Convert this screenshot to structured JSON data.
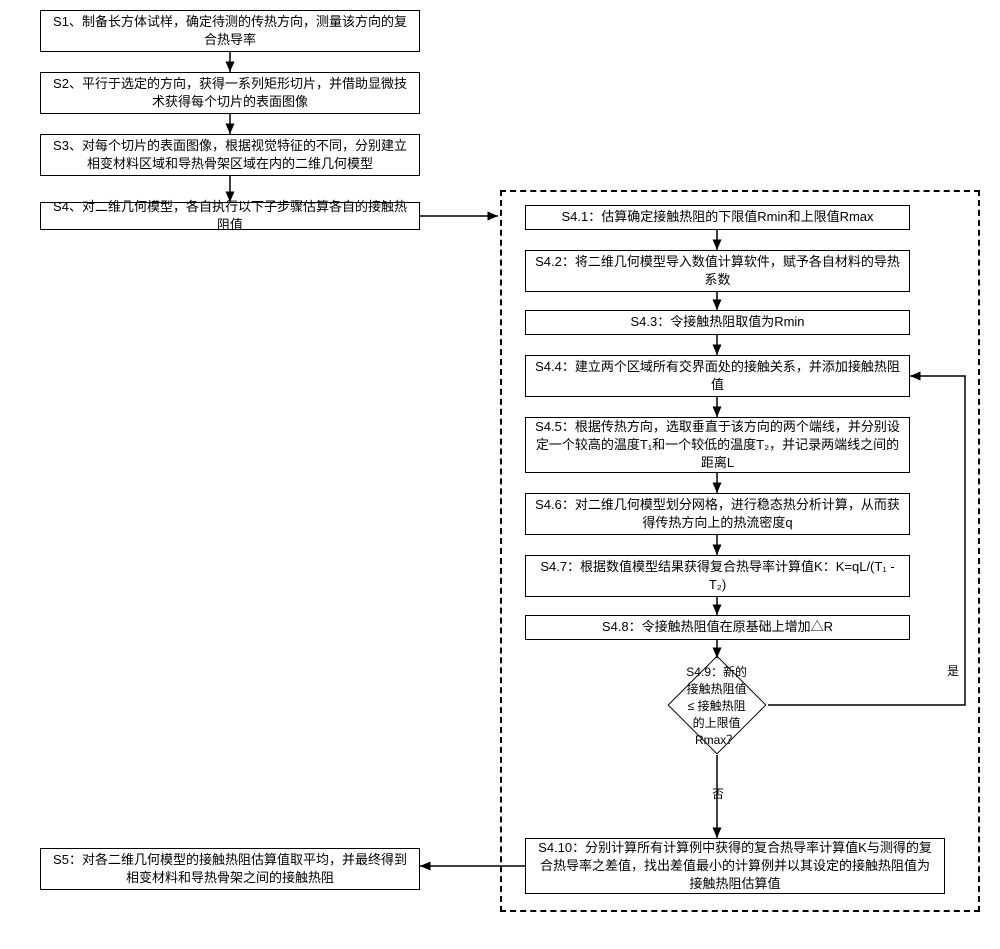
{
  "chart_data": {
    "type": "flowchart",
    "title": "",
    "nodes": [
      {
        "id": "S1",
        "type": "process",
        "text": "S1、制备长方体试样，确定待测的传热方向，测量该方向的复合热导率"
      },
      {
        "id": "S2",
        "type": "process",
        "text": "S2、平行于选定的方向，获得一系列矩形切片，并借助显微技术获得每个切片的表面图像"
      },
      {
        "id": "S3",
        "type": "process",
        "text": "S3、对每个切片的表面图像，根据视觉特征的不同，分别建立相变材料区域和导热骨架区域在内的二维几何模型"
      },
      {
        "id": "S4",
        "type": "process",
        "text": "S4、对二维几何模型，各自执行以下子步骤估算各自的接触热阻值"
      },
      {
        "id": "S4.1",
        "type": "process",
        "text": "S4.1：估算确定接触热阻的下限值Rmin和上限值Rmax"
      },
      {
        "id": "S4.2",
        "type": "process",
        "text": "S4.2：将二维几何模型导入数值计算软件，赋予各自材料的导热系数"
      },
      {
        "id": "S4.3",
        "type": "process",
        "text": "S4.3：令接触热阻取值为Rmin"
      },
      {
        "id": "S4.4",
        "type": "process",
        "text": "S4.4：建立两个区域所有交界面处的接触关系，并添加接触热阻值"
      },
      {
        "id": "S4.5",
        "type": "process",
        "text": "S4.5：根据传热方向，选取垂直于该方向的两个端线，并分别设定一个较高的温度T₁和一个较低的温度T₂，并记录两端线之间的距离L"
      },
      {
        "id": "S4.6",
        "type": "process",
        "text": "S4.6：对二维几何模型划分网格，进行稳态热分析计算，从而获得传热方向上的热流密度q"
      },
      {
        "id": "S4.7",
        "type": "process",
        "text": "S4.7：根据数值模型结果获得复合热导率计算值K：K=qL/(T₁ - T₂)"
      },
      {
        "id": "S4.8",
        "type": "process",
        "text": "S4.8：令接触热阻值在原基础上增加△R"
      },
      {
        "id": "S4.9",
        "type": "decision",
        "text": "S4.9：新的接触热阻值 ≤ 接触热阻的上限值Rmax？"
      },
      {
        "id": "S4.10",
        "type": "process",
        "text": "S4.10：分别计算所有计算例中获得的复合热导率计算值K与测得的复合热导率之差值，找出差值最小的计算例并以其设定的接触热阻值为接触热阻估算值"
      },
      {
        "id": "S5",
        "type": "process",
        "text": "S5：对各二维几何模型的接触热阻估算值取平均，并最终得到相变材料和导热骨架之间的接触热阻"
      }
    ],
    "edges": [
      {
        "from": "S1",
        "to": "S2"
      },
      {
        "from": "S2",
        "to": "S3"
      },
      {
        "from": "S3",
        "to": "S4"
      },
      {
        "from": "S4",
        "to": "S4.1"
      },
      {
        "from": "S4.1",
        "to": "S4.2"
      },
      {
        "from": "S4.2",
        "to": "S4.3"
      },
      {
        "from": "S4.3",
        "to": "S4.4"
      },
      {
        "from": "S4.4",
        "to": "S4.5"
      },
      {
        "from": "S4.5",
        "to": "S4.6"
      },
      {
        "from": "S4.6",
        "to": "S4.7"
      },
      {
        "from": "S4.7",
        "to": "S4.8"
      },
      {
        "from": "S4.8",
        "to": "S4.9"
      },
      {
        "from": "S4.9",
        "to": "S4.4",
        "label": "是"
      },
      {
        "from": "S4.9",
        "to": "S4.10",
        "label": "否"
      },
      {
        "from": "S4.10",
        "to": "S5"
      }
    ]
  },
  "steps": {
    "s1": "S1、制备长方体试样，确定待测的传热方向，测量该方向的复合热导率",
    "s2": "S2、平行于选定的方向，获得一系列矩形切片，并借助显微技术获得每个切片的表面图像",
    "s3": "S3、对每个切片的表面图像，根据视觉特征的不同，分别建立相变材料区域和导热骨架区域在内的二维几何模型",
    "s4": "S4、对二维几何模型，各自执行以下子步骤估算各自的接触热阻值",
    "s4_1": "S4.1：估算确定接触热阻的下限值Rmin和上限值Rmax",
    "s4_2": "S4.2：将二维几何模型导入数值计算软件，赋予各自材料的导热系数",
    "s4_3": "S4.3：令接触热阻取值为Rmin",
    "s4_4": "S4.4：建立两个区域所有交界面处的接触关系，并添加接触热阻值",
    "s4_5": "S4.5：根据传热方向，选取垂直于该方向的两个端线，并分别设定一个较高的温度T₁和一个较低的温度T₂，并记录两端线之间的距离L",
    "s4_6": "S4.6：对二维几何模型划分网格，进行稳态热分析计算，从而获得传热方向上的热流密度q",
    "s4_7": "S4.7：根据数值模型结果获得复合热导率计算值K：K=qL/(T₁ - T₂)",
    "s4_8": "S4.8：令接触热阻值在原基础上增加△R",
    "s4_9": "S4.9：新的接触热阻值 ≤ 接触热阻的上限值Rmax？",
    "s4_10": "S4.10：分别计算所有计算例中获得的复合热导率计算值K与测得的复合热导率之差值，找出差值最小的计算例并以其设定的接触热阻值为接触热阻估算值",
    "s5": "S5：对各二维几何模型的接触热阻估算值取平均，并最终得到相变材料和导热骨架之间的接触热阻"
  },
  "labels": {
    "yes": "是",
    "no": "否"
  }
}
